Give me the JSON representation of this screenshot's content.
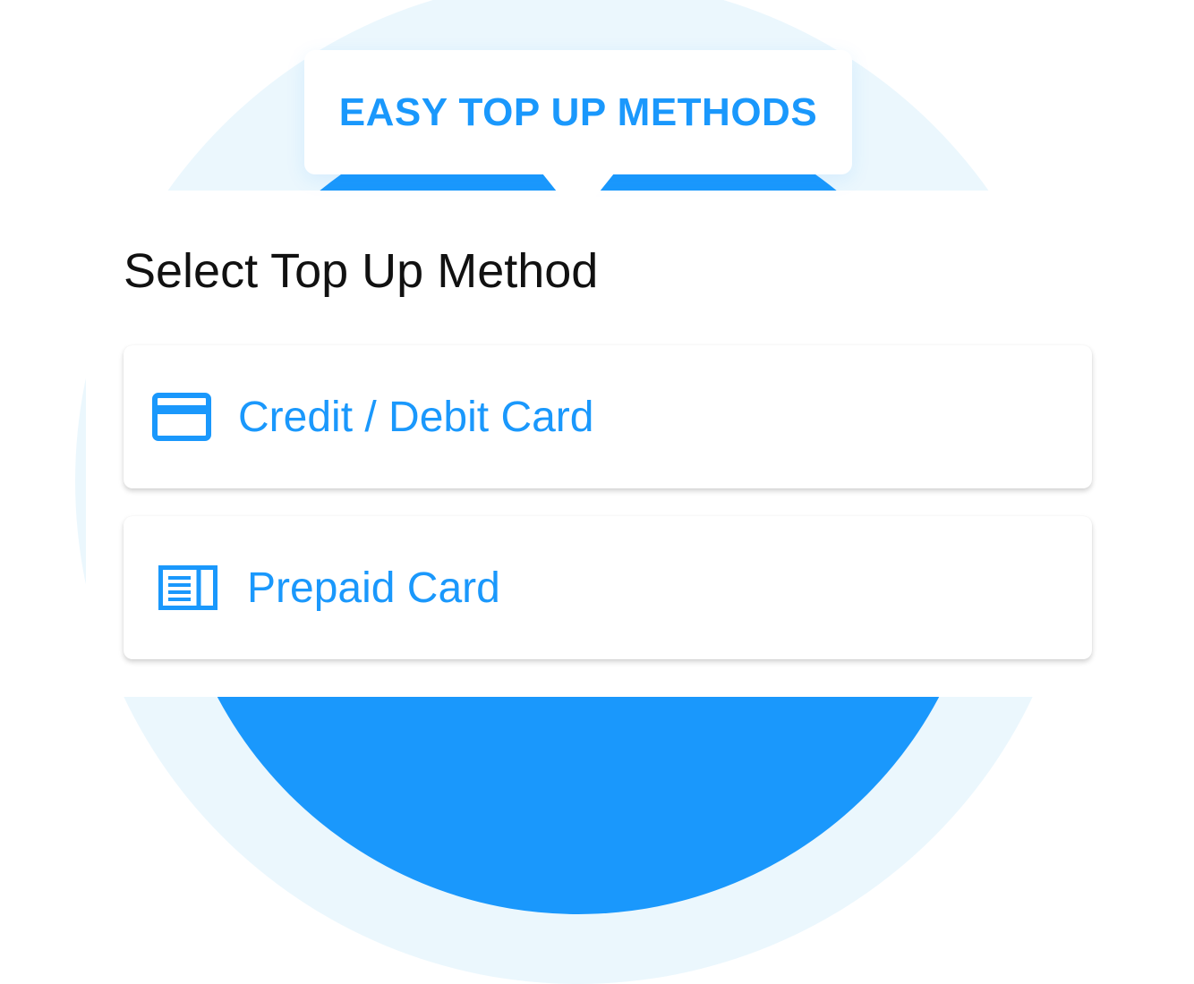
{
  "colors": {
    "accent": "#1a98fc",
    "outer_circle": "#ebf7fd",
    "title_text": "#111111",
    "card_background": "#ffffff"
  },
  "banner": {
    "text": "EASY TOP UP METHODS"
  },
  "page": {
    "title": "Select Top Up Method"
  },
  "methods": [
    {
      "label": "Credit / Debit Card",
      "icon": "credit-card-icon"
    },
    {
      "label": "Prepaid Card",
      "icon": "prepaid-card-icon"
    }
  ]
}
